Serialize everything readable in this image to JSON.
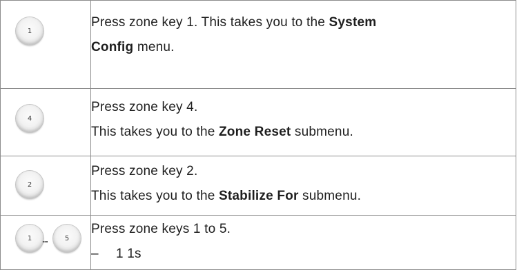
{
  "steps": [
    {
      "keys": [
        "1"
      ],
      "line1": {
        "pre": "Press zone key 1. This takes you to the ",
        "bold": "System"
      },
      "line2": {
        "bold": "Config",
        "post": " menu."
      }
    },
    {
      "keys": [
        "4"
      ],
      "line1": {
        "pre": "Press zone key 4."
      },
      "line2": {
        "pre": "This takes you to the ",
        "bold": "Zone Reset",
        "post": " submenu."
      }
    },
    {
      "keys": [
        "2"
      ],
      "line1": {
        "pre": "Press zone key 2."
      },
      "line2": {
        "pre": "This takes you to the ",
        "bold": "Stabilize For",
        "post": " submenu."
      }
    },
    {
      "keys": [
        "1",
        "5"
      ],
      "range_separator": "...",
      "line1": {
        "pre": "Press zone keys 1 to 5."
      },
      "line2": {
        "dash": "–",
        "post": "1 1s"
      }
    }
  ]
}
